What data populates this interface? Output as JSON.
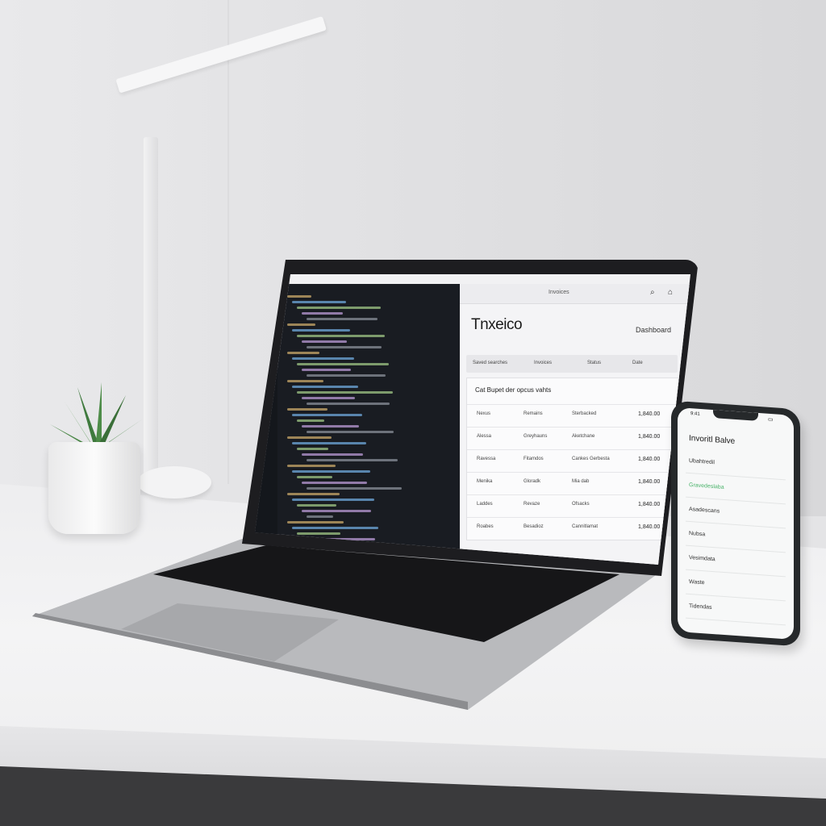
{
  "laptop": {
    "app": {
      "url": "Invoices",
      "brand": "Tnxeico",
      "nav_link": "Dashboard",
      "filters": [
        "Saved searches",
        "Invoices",
        "Status",
        "Date"
      ],
      "table_title": "Cat Bupet der opcus vahts",
      "rows": [
        {
          "c1": "Nexus",
          "c2": "Remains",
          "c3": "Sterbacked",
          "amount": "1,840.00"
        },
        {
          "c1": "Alessa",
          "c2": "Greyhauns",
          "c3": "Aketchane",
          "amount": "1,840.00"
        },
        {
          "c1": "Ravessa",
          "c2": "Fitamdos",
          "c3": "Cankes Gerbesta",
          "amount": "1,840.00"
        },
        {
          "c1": "Menika",
          "c2": "Gloradk",
          "c3": "Mia dab",
          "amount": "1,840.00"
        },
        {
          "c1": "Laddes",
          "c2": "Revaze",
          "c3": "Ofsacks",
          "amount": "1,840.00"
        },
        {
          "c1": "Roabes",
          "c2": "Besadioz",
          "c3": "Cannitlamat",
          "amount": "1,840.00"
        }
      ]
    }
  },
  "phone": {
    "time": "9:41",
    "title": "Invoritl Balve",
    "items": [
      "Ubahtredil",
      "Gravedeslaba",
      "Asadescans",
      "Nubsa",
      "Vesimdata",
      "Waste",
      "Tidendas"
    ]
  },
  "colors": {
    "wall": "#e4e4e6",
    "editor_bg": "#191c22",
    "phone_accent": "#4bb36b"
  }
}
